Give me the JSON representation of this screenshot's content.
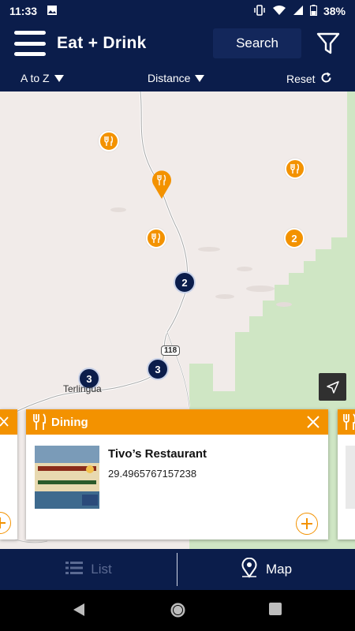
{
  "status": {
    "time": "11:33",
    "battery": "38%"
  },
  "header": {
    "title": "Eat + Drink",
    "search_label": "Search"
  },
  "sort": {
    "alpha_label": "A to Z",
    "distance_label": "Distance",
    "reset_label": "Reset"
  },
  "map": {
    "town_label": "Terlingua",
    "road_label": "118",
    "clusters": {
      "c1": "2",
      "c2": "2",
      "c3": "3",
      "c4": "3"
    }
  },
  "card": {
    "category": "Dining",
    "name": "Tivo’s Restaurant",
    "coordinate": "29.4965767157238",
    "thumb_text": "TIVO'S PLACE MEXICAN FOOD"
  },
  "tabs": {
    "list_label": "List",
    "map_label": "Map"
  },
  "colors": {
    "navy": "#0b1d4b",
    "orange": "#f39200",
    "map_bg": "#f1ebe9",
    "park_green": "#cfe6c4"
  }
}
